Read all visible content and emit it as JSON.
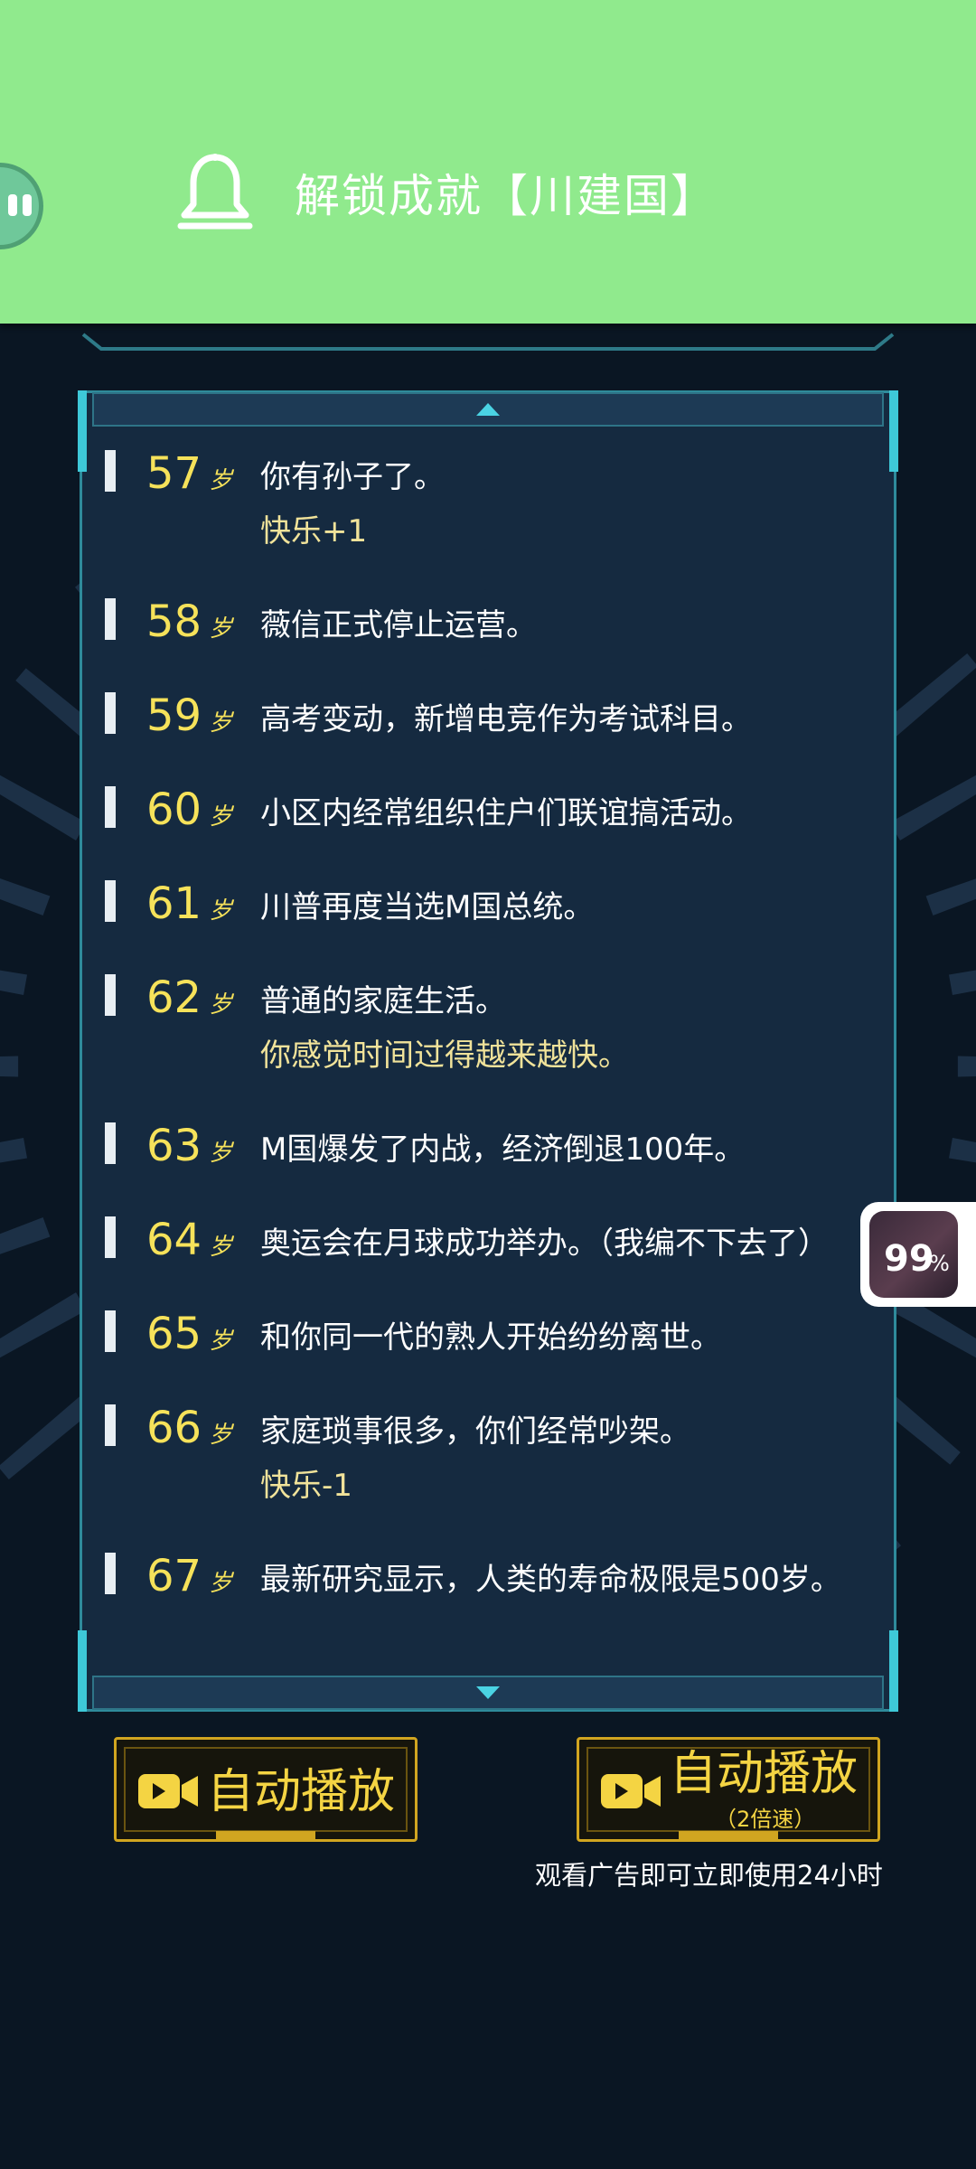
{
  "notification": {
    "text": "解锁成就【川建国】",
    "icon": "bell-icon",
    "avatar_icon": "app-avatar-icon"
  },
  "events": [
    {
      "age": "57",
      "unit": "岁",
      "text": "你有孙子了。",
      "sub": "快乐+1"
    },
    {
      "age": "58",
      "unit": "岁",
      "text": "薇信正式停止运营。",
      "sub": ""
    },
    {
      "age": "59",
      "unit": "岁",
      "text": "高考变动，新增电竞作为考试科目。",
      "sub": ""
    },
    {
      "age": "60",
      "unit": "岁",
      "text": "小区内经常组织住户们联谊搞活动。",
      "sub": ""
    },
    {
      "age": "61",
      "unit": "岁",
      "text": "川普再度当选M国总统。",
      "sub": ""
    },
    {
      "age": "62",
      "unit": "岁",
      "text": "普通的家庭生活。",
      "sub": "你感觉时间过得越来越快。"
    },
    {
      "age": "63",
      "unit": "岁",
      "text": "M国爆发了内战，经济倒退100年。",
      "sub": ""
    },
    {
      "age": "64",
      "unit": "岁",
      "text": "奥运会在月球成功举办。（我编不下去了）",
      "sub": ""
    },
    {
      "age": "65",
      "unit": "岁",
      "text": "和你同一代的熟人开始纷纷离世。",
      "sub": ""
    },
    {
      "age": "66",
      "unit": "岁",
      "text": "家庭琐事很多，你们经常吵架。",
      "sub": "快乐-1"
    },
    {
      "age": "67",
      "unit": "岁",
      "text": "最新研究显示，人类的寿命极限是500岁。",
      "sub": ""
    }
  ],
  "buttons": {
    "auto_play": {
      "label": "自动播放",
      "icon": "video-camera-icon"
    },
    "auto_play_fast": {
      "label": "自动播放",
      "sublabel": "（2倍速）",
      "icon": "video-camera-icon"
    },
    "ad_note": "观看广告即可立即使用24小时"
  },
  "floating_widget": {
    "number": "99",
    "unit": "%"
  },
  "colors": {
    "banner": "#90ea8d",
    "background": "#0a1623",
    "panel": "#152a40",
    "panel_border": "#2f8b9b",
    "age": "#f6e25a",
    "sub_text": "#f1e39a",
    "button_gold": "#d1a520"
  }
}
